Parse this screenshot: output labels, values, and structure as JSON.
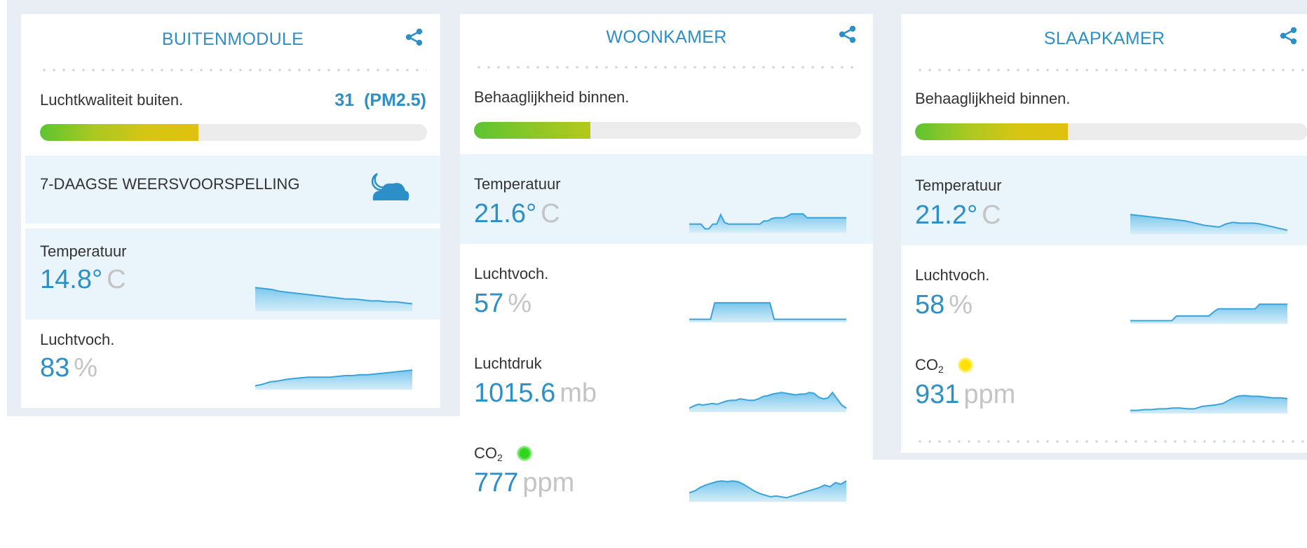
{
  "colors": {
    "accent": "#2d8fc7",
    "unit": "#c4c4c4",
    "co2_good": "#31d51b",
    "co2_warn": "#ffe100"
  },
  "modules": [
    {
      "title": "BUITENMODULE",
      "icon": "share-icon",
      "index_label": "Luchtkwaliteit buiten.",
      "index_value": "31  (PM2.5)",
      "index_fill": 0.41,
      "forecast_label": "7-DAAGSE WEERSVOORSPELLING",
      "forecast_icon": "moon-cloud-icon",
      "metrics": [
        {
          "label": "Temperatuur",
          "value": "14.8°",
          "unit": "C",
          "trend": [
            24,
            23,
            22,
            20,
            19,
            18,
            17,
            16,
            15,
            14,
            13,
            12,
            12,
            11,
            10,
            10,
            9,
            9,
            8,
            7
          ]
        },
        {
          "label": "Luchtvoch.",
          "value": "83",
          "unit": "%",
          "trend": [
            4,
            6,
            9,
            10,
            12,
            13,
            14,
            15,
            15,
            15,
            15,
            16,
            17,
            17,
            18,
            18,
            19,
            20,
            21,
            22,
            23,
            24
          ]
        }
      ]
    },
    {
      "title": "WOONKAMER",
      "icon": "share-icon",
      "index_label": "Behaaglijkheid binnen.",
      "index_fill": 0.3,
      "metrics": [
        {
          "label": "Temperatuur",
          "value": "21.6°",
          "unit": "C",
          "trend": [
            10,
            10,
            10,
            10,
            4,
            4,
            10,
            10,
            22,
            12,
            10,
            10,
            10,
            10,
            10,
            10,
            10,
            10,
            10,
            14,
            14,
            17,
            18,
            18,
            18,
            20,
            23,
            23,
            23,
            23,
            18,
            18,
            18,
            18,
            18,
            18,
            18,
            18,
            18,
            18,
            18
          ]
        },
        {
          "label": "Luchtvoch.",
          "value": "57",
          "unit": "%",
          "trend": [
            3,
            3,
            3,
            3,
            3,
            3,
            24,
            24,
            24,
            24,
            24,
            24,
            24,
            24,
            24,
            24,
            24,
            24,
            24,
            24,
            3,
            3,
            3,
            3,
            3,
            3,
            3,
            3,
            3,
            3,
            3,
            3,
            3,
            3,
            3,
            3,
            3,
            3
          ]
        },
        {
          "label": "Luchtdruk",
          "value": "1015.6",
          "unit": "mb",
          "trend": [
            4,
            7,
            9,
            8,
            9,
            10,
            9,
            11,
            13,
            14,
            14,
            16,
            15,
            14,
            14,
            16,
            19,
            20,
            22,
            23,
            24,
            23,
            22,
            21,
            22,
            22,
            24,
            23,
            18,
            16,
            17,
            24,
            16,
            8,
            4
          ]
        },
        {
          "label": "CO",
          "sub": "2",
          "value": "777",
          "unit": "ppm",
          "indicator": "green",
          "trend": [
            10,
            12,
            16,
            19,
            21,
            23,
            24,
            23,
            24,
            23,
            20,
            16,
            12,
            9,
            7,
            5,
            6,
            5,
            4,
            6,
            8,
            10,
            12,
            14,
            16,
            19,
            17,
            22,
            20,
            24
          ]
        }
      ]
    },
    {
      "title": "SLAAPKAMER",
      "icon": "share-icon",
      "index_label": "Behaaglijkheid binnen.",
      "index_fill": 0.39,
      "metrics": [
        {
          "label": "Temperatuur",
          "value": "21.2°",
          "unit": "C",
          "trend": [
            24,
            23,
            22,
            21,
            20,
            19,
            18,
            17,
            16,
            14,
            12,
            10,
            9,
            8,
            12,
            14,
            13,
            13,
            13,
            12,
            10,
            8,
            6,
            4
          ]
        },
        {
          "label": "Luchtvoch.",
          "value": "58",
          "unit": "%",
          "trend": [
            3,
            3,
            3,
            3,
            3,
            3,
            3,
            3,
            3,
            3,
            9,
            9,
            9,
            9,
            9,
            9,
            9,
            9,
            14,
            18,
            18,
            18,
            18,
            18,
            18,
            18,
            18,
            18,
            24,
            24,
            24,
            24,
            24,
            24,
            24
          ]
        },
        {
          "label": "CO",
          "sub": "2",
          "value": "931",
          "unit": "ppm",
          "indicator": "yellow",
          "trend": [
            3,
            3,
            4,
            4,
            5,
            5,
            6,
            6,
            5,
            5,
            8,
            9,
            10,
            12,
            17,
            21,
            22,
            21,
            21,
            20,
            19,
            19,
            18
          ]
        }
      ]
    }
  ]
}
